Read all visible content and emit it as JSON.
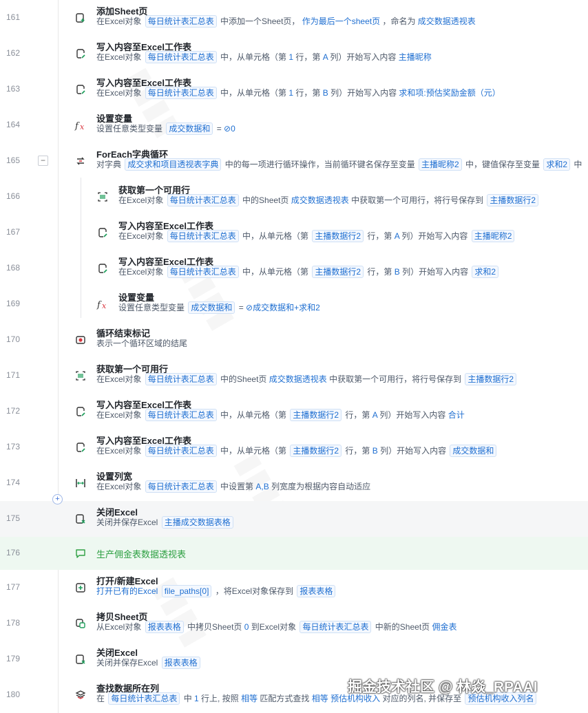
{
  "rows": [
    {
      "line": "161",
      "icon": "add-sheet-icon",
      "title": "添加Sheet页",
      "desc": [
        {
          "t": "在Excel对象"
        },
        {
          "tag": "每日统计表汇总表"
        },
        {
          "t": "中添加一个Sheet页，"
        },
        {
          "v": "作为最后一个sheet页"
        },
        {
          "t": "，命名为"
        },
        {
          "v": "成交数据透视表"
        }
      ]
    },
    {
      "line": "162",
      "icon": "write-excel-icon",
      "title": "写入内容至Excel工作表",
      "desc": [
        {
          "t": "在Excel对象"
        },
        {
          "tag": "每日统计表汇总表"
        },
        {
          "t": "中，从单元格（第"
        },
        {
          "v": "1"
        },
        {
          "t": "行，第"
        },
        {
          "v": "A"
        },
        {
          "t": "列）开始写入内容"
        },
        {
          "v": "主播昵称"
        }
      ]
    },
    {
      "line": "163",
      "icon": "write-excel-icon",
      "title": "写入内容至Excel工作表",
      "desc": [
        {
          "t": "在Excel对象"
        },
        {
          "tag": "每日统计表汇总表"
        },
        {
          "t": "中，从单元格（第"
        },
        {
          "v": "1"
        },
        {
          "t": "行，第"
        },
        {
          "v": "B"
        },
        {
          "t": "列）开始写入内容"
        },
        {
          "v": "求和项:预估奖励金额（元）"
        }
      ]
    },
    {
      "line": "164",
      "icon": "fx-icon",
      "title": "设置变量",
      "desc": [
        {
          "t": "设置任意类型变量"
        },
        {
          "tag": "成交数据和"
        },
        {
          "t": "="
        },
        {
          "v": "⊘0"
        }
      ]
    },
    {
      "line": "165",
      "icon": "foreach-loop-icon",
      "title": "ForEach字典循环",
      "fold": true,
      "desc": [
        {
          "t": "对字典"
        },
        {
          "tag": "成交求和项目透视表字典"
        },
        {
          "t": "中的每一项进行循环操作，当前循环键名保存至变量"
        },
        {
          "tag": "主播昵称2"
        },
        {
          "t": "中，键值保存至变量"
        },
        {
          "tag": "求和2"
        },
        {
          "t": "中"
        }
      ]
    },
    {
      "line": "166",
      "icon": "get-row-icon",
      "title": "获取第一个可用行",
      "indent": true,
      "desc": [
        {
          "t": "在Excel对象"
        },
        {
          "tag": "每日统计表汇总表"
        },
        {
          "t": "中的Sheet页"
        },
        {
          "v": "成交数据透视表"
        },
        {
          "t": "中获取第一个可用行，将行号保存到"
        },
        {
          "tag": "主播数据行2"
        }
      ]
    },
    {
      "line": "167",
      "icon": "write-excel-icon",
      "title": "写入内容至Excel工作表",
      "indent": true,
      "desc": [
        {
          "t": "在Excel对象"
        },
        {
          "tag": "每日统计表汇总表"
        },
        {
          "t": "中，从单元格（第"
        },
        {
          "tag": "主播数据行2"
        },
        {
          "t": "行，第"
        },
        {
          "v": "A"
        },
        {
          "t": "列）开始写入内容"
        },
        {
          "tag": "主播昵称2"
        }
      ]
    },
    {
      "line": "168",
      "icon": "write-excel-icon",
      "title": "写入内容至Excel工作表",
      "indent": true,
      "desc": [
        {
          "t": "在Excel对象"
        },
        {
          "tag": "每日统计表汇总表"
        },
        {
          "t": "中，从单元格（第"
        },
        {
          "tag": "主播数据行2"
        },
        {
          "t": "行，第"
        },
        {
          "v": "B"
        },
        {
          "t": "列）开始写入内容"
        },
        {
          "tag": "求和2"
        }
      ]
    },
    {
      "line": "169",
      "icon": "fx-icon",
      "title": "设置变量",
      "indent": true,
      "desc": [
        {
          "t": "设置任意类型变量"
        },
        {
          "tag": "成交数据和"
        },
        {
          "t": "="
        },
        {
          "v": "⊘成交数据和+求和2"
        }
      ]
    },
    {
      "line": "170",
      "icon": "loop-end-icon",
      "title": "循环结束标记",
      "desc": [
        {
          "t": "表示一个循环区域的结尾"
        }
      ]
    },
    {
      "line": "171",
      "icon": "get-row-icon",
      "title": "获取第一个可用行",
      "desc": [
        {
          "t": "在Excel对象"
        },
        {
          "tag": "每日统计表汇总表"
        },
        {
          "t": "中的Sheet页"
        },
        {
          "v": "成交数据透视表"
        },
        {
          "t": "中获取第一个可用行，将行号保存到"
        },
        {
          "tag": "主播数据行2"
        }
      ]
    },
    {
      "line": "172",
      "icon": "write-excel-icon",
      "title": "写入内容至Excel工作表",
      "desc": [
        {
          "t": "在Excel对象"
        },
        {
          "tag": "每日统计表汇总表"
        },
        {
          "t": "中，从单元格（第"
        },
        {
          "tag": "主播数据行2"
        },
        {
          "t": "行，第"
        },
        {
          "v": "A"
        },
        {
          "t": "列）开始写入内容"
        },
        {
          "v": "合计"
        }
      ]
    },
    {
      "line": "173",
      "icon": "write-excel-icon",
      "title": "写入内容至Excel工作表",
      "desc": [
        {
          "t": "在Excel对象"
        },
        {
          "tag": "每日统计表汇总表"
        },
        {
          "t": "中，从单元格（第"
        },
        {
          "tag": "主播数据行2"
        },
        {
          "t": "行，第"
        },
        {
          "v": "B"
        },
        {
          "t": "列）开始写入内容"
        },
        {
          "tag": "成交数据和"
        }
      ]
    },
    {
      "line": "174",
      "icon": "column-width-icon",
      "title": "设置列宽",
      "desc": [
        {
          "t": "在Excel对象"
        },
        {
          "tag": "每日统计表汇总表"
        },
        {
          "t": "中设置第"
        },
        {
          "v": "A,B"
        },
        {
          "t": "列宽度为根据内容自动适应"
        }
      ]
    },
    {
      "line": "175",
      "icon": "close-excel-icon",
      "title": "关闭Excel",
      "hl": true,
      "desc": [
        {
          "t": "关闭并保存Excel"
        },
        {
          "tag": "主播成交数据表格"
        }
      ]
    },
    {
      "line": "176",
      "icon": "comment-icon",
      "comment": "生产佣金表数据透视表"
    },
    {
      "line": "177",
      "icon": "open-excel-icon",
      "title": "打开/新建Excel",
      "desc": [
        {
          "v": "打开已有的Excel"
        },
        {
          "tag": "file_paths[0]"
        },
        {
          "t": "，将Excel对象保存到"
        },
        {
          "tag": "报表表格"
        }
      ]
    },
    {
      "line": "178",
      "icon": "copy-sheet-icon",
      "title": "拷贝Sheet页",
      "desc": [
        {
          "t": "从Excel对象"
        },
        {
          "tag": "报表表格"
        },
        {
          "t": "中拷贝Sheet页"
        },
        {
          "v": "0"
        },
        {
          "t": "到Excel对象"
        },
        {
          "tag": "每日统计表汇总表"
        },
        {
          "t": "中新的Sheet页"
        },
        {
          "v": "佣金表"
        }
      ]
    },
    {
      "line": "179",
      "icon": "close-excel-icon",
      "title": "关闭Excel",
      "desc": [
        {
          "t": "关闭并保存Excel"
        },
        {
          "tag": "报表表格"
        }
      ]
    },
    {
      "line": "180",
      "icon": "find-column-icon",
      "title": "查找数据所在列",
      "desc": [
        {
          "t": "在"
        },
        {
          "tag": "每日统计表汇总表"
        },
        {
          "t": "中"
        },
        {
          "v": "1"
        },
        {
          "t": "行上, 按照"
        },
        {
          "v": "相等"
        },
        {
          "t": "匹配方式查找"
        },
        {
          "v": "相等"
        },
        {
          "v": "预估机构收入"
        },
        {
          "t": "对应的列名, 并保存至"
        },
        {
          "tag": "预估机构收入列名"
        }
      ]
    }
  ],
  "fold_symbol": "−",
  "add_symbol": "+",
  "watermark_text": "掘金技术社区 @ 林焱_RPAAI",
  "colors": {
    "accent": "#1f6fd1",
    "comment": "#2ea043",
    "excel_green": "#1e9e5b",
    "fx_red": "#d9363e"
  }
}
